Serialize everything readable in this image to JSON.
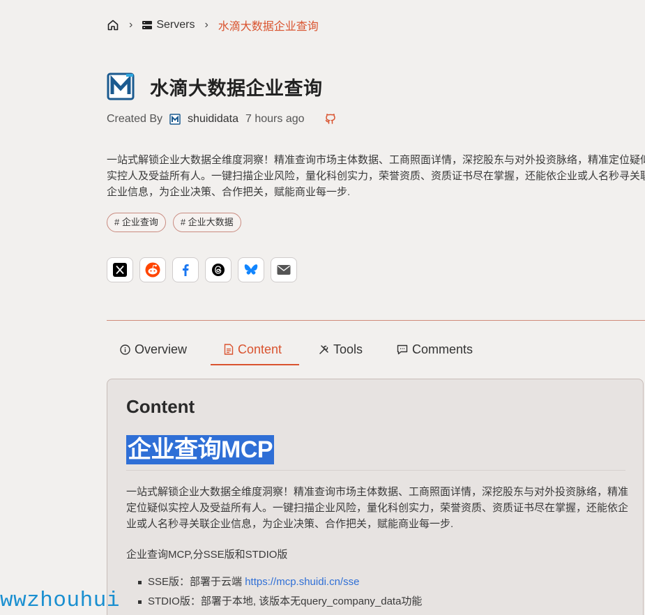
{
  "breadcrumb": {
    "servers_label": "Servers",
    "current_label": "水滴大数据企业查询"
  },
  "header": {
    "title": "水滴大数据企业查询",
    "created_by_label": "Created By",
    "author": "shuididata",
    "time_ago": "7 hours ago"
  },
  "description": "一站式解锁企业大数据全维度洞察！精准查询市场主体数据、工商照面详情，深挖股东与对外投资脉络，精准定位疑似实控人及受益所有人。一键扫描企业风险，量化科创实力，荣誉资质、资质证书尽在掌握，还能依企业或人名秒寻关联企业信息，为企业决策、合作把关，赋能商业每一步.",
  "tags": [
    "# 企业查询",
    "# 企业大数据"
  ],
  "share_icons": [
    "x-icon",
    "reddit-icon",
    "facebook-icon",
    "threads-icon",
    "bluesky-icon",
    "email-icon"
  ],
  "tabs": [
    {
      "label": "Overview",
      "icon": "info-icon"
    },
    {
      "label": "Content",
      "icon": "document-icon",
      "active": true
    },
    {
      "label": "Tools",
      "icon": "tools-icon"
    },
    {
      "label": "Comments",
      "icon": "comment-icon"
    }
  ],
  "content": {
    "title": "Content",
    "heading": "企业查询MCP",
    "paragraph": "一站式解锁企业大数据全维度洞察！精准查询市场主体数据、工商照面详情，深挖股东与对外投资脉络，精准定位疑似实控人及受益所有人。一键扫描企业风险，量化科创实力，荣誉资质、资质证书尽在掌握，还能依企业或人名秒寻关联企业信息，为企业决策、合作把关，赋能商业每一步.",
    "line2": "企业查询MCP,分SSE版和STDIO版",
    "bullets": [
      {
        "prefix": "SSE版：部署于云端 ",
        "link": "https://mcp.shuidi.cn/sse"
      },
      {
        "prefix": "STDIO版：部署于本地, 该版本无query_company_data功能",
        "link": ""
      }
    ]
  },
  "watermark": "wwzhouhui",
  "colors": {
    "accent": "#d9532f",
    "link": "#2f6fd6",
    "background": "#f2f0ee"
  }
}
